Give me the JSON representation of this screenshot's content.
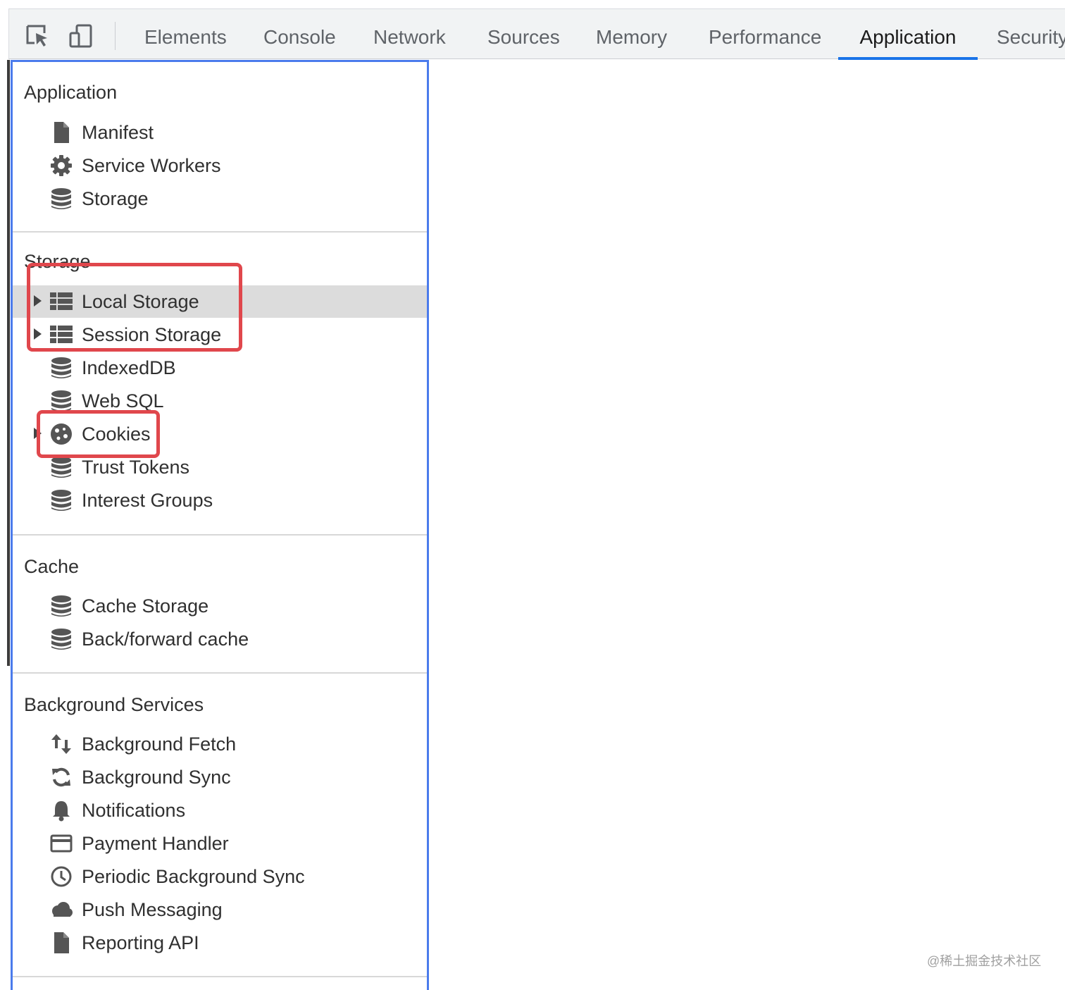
{
  "toolbar": {
    "tabs": [
      {
        "label": "Elements"
      },
      {
        "label": "Console"
      },
      {
        "label": "Network"
      },
      {
        "label": "Sources"
      },
      {
        "label": "Memory"
      },
      {
        "label": "Performance"
      },
      {
        "label": "Application",
        "active": true
      },
      {
        "label": "Security"
      }
    ]
  },
  "sidebar": {
    "sections": [
      {
        "title": "Application",
        "items": [
          {
            "label": "Manifest",
            "icon": "document-icon"
          },
          {
            "label": "Service Workers",
            "icon": "gear-icon"
          },
          {
            "label": "Storage",
            "icon": "database-icon"
          }
        ]
      },
      {
        "title": "Storage",
        "items": [
          {
            "label": "Local Storage",
            "icon": "grid-icon",
            "expandable": true,
            "selected": true
          },
          {
            "label": "Session Storage",
            "icon": "grid-icon",
            "expandable": true
          },
          {
            "label": "IndexedDB",
            "icon": "database-icon"
          },
          {
            "label": "Web SQL",
            "icon": "database-icon"
          },
          {
            "label": "Cookies",
            "icon": "cookie-icon",
            "expandable": true
          },
          {
            "label": "Trust Tokens",
            "icon": "database-icon"
          },
          {
            "label": "Interest Groups",
            "icon": "database-icon"
          }
        ]
      },
      {
        "title": "Cache",
        "items": [
          {
            "label": "Cache Storage",
            "icon": "database-icon"
          },
          {
            "label": "Back/forward cache",
            "icon": "database-icon"
          }
        ]
      },
      {
        "title": "Background Services",
        "items": [
          {
            "label": "Background Fetch",
            "icon": "up-down-arrows-icon"
          },
          {
            "label": "Background Sync",
            "icon": "sync-icon"
          },
          {
            "label": "Notifications",
            "icon": "bell-icon"
          },
          {
            "label": "Payment Handler",
            "icon": "card-icon"
          },
          {
            "label": "Periodic Background Sync",
            "icon": "clock-icon"
          },
          {
            "label": "Push Messaging",
            "icon": "cloud-icon"
          },
          {
            "label": "Reporting API",
            "icon": "document-icon"
          }
        ]
      }
    ]
  },
  "watermark": "@稀土掘金技术社区",
  "colors": {
    "accent": "#1a73e8",
    "sidebar_border": "#4b7bec",
    "highlight_box": "#e0474c",
    "selected_row": "#dcdcdc"
  }
}
